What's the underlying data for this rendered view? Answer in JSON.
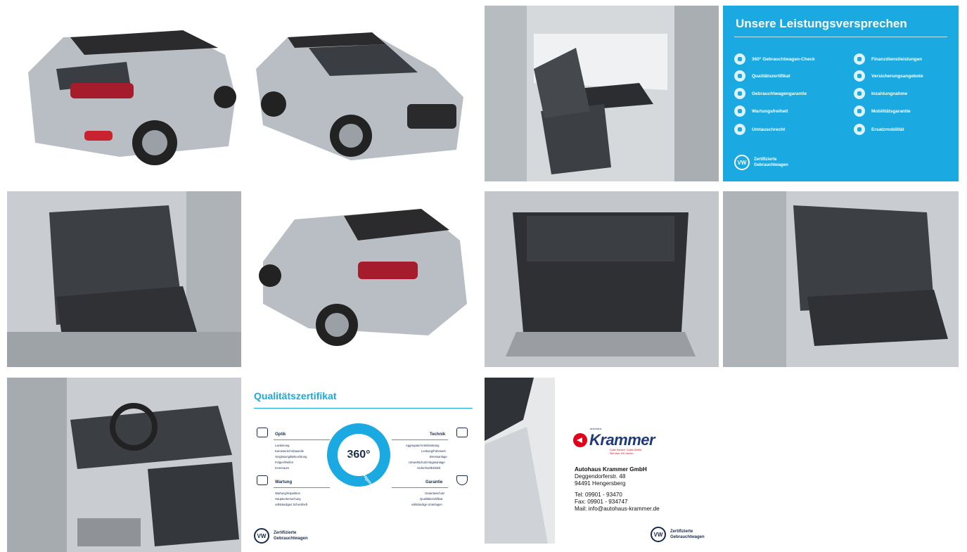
{
  "gallery": {
    "photos": [
      {
        "subject": "rear-three-quarter-exterior"
      },
      {
        "subject": "front-three-quarter-exterior"
      },
      {
        "subject": "front-passenger-interior"
      },
      {
        "subject": "rear-seats-interior"
      },
      {
        "subject": "rear-three-quarter-exterior-left"
      },
      {
        "subject": "trunk-cargo-area"
      },
      {
        "subject": "rear-seats-interior-right"
      },
      {
        "subject": "driver-cockpit-interior"
      }
    ]
  },
  "promise_card": {
    "title": "Unsere Leistungsversprechen",
    "left_items": [
      "360° Gebrauchtwagen-Check",
      "Qualitätszertifikat",
      "Gebrauchtwagengarantie",
      "Wartungsfreiheit",
      "Umtauschrecht"
    ],
    "right_items": [
      "Finanzdienstleistungen",
      "Versicherungsangebote",
      "Inzahlungnahme",
      "Mobilitätsgarantie",
      "Ersatzmobilität"
    ],
    "footer_line1": "Zertifizierte",
    "footer_line2": "Gebrauchtwagen",
    "logo_text": "VW",
    "background": "#1ba9e1"
  },
  "cert_card": {
    "title": "Qualitätszertifikat",
    "optik_title": "Optik",
    "optik_items": [
      "Lackierung",
      "Karosserie/Anbauteile",
      "Verglasung/Beleuchtung",
      "Felgen/Reifen",
      "Innenraum"
    ],
    "technik_title": "Technik",
    "technik_items": [
      "Aggregate/Antriebsstrang",
      "Lenkung/Fahrwerk",
      "Bremsanlage",
      "Umweltschutz/Abgasanlage",
      "Sicherheit/Elektrik"
    ],
    "wartung_title": "Wartung",
    "wartung_items": [
      "Wartung/Inspektion",
      "Hauptuntersuchung",
      "vollständiges Scheckheft"
    ],
    "garantie_title": "Garantie",
    "garantie_items": [
      "Garantieschutz",
      "Qualitätszertifikat",
      "vollständige Unterlagen"
    ],
    "center_text": "360°",
    "ring_text": "Gebrauchtwagen-Check",
    "footer_line1": "Zertifizierte",
    "footer_line2": "Gebrauchtwagen",
    "logo_text": "VW"
  },
  "dealer_card": {
    "small_top": "autohaus",
    "brand": "Krammer",
    "slogan_1": "Guter Service. Gutes Gefühl.",
    "slogan_2": "Seit über 100 Jahren.",
    "company": "Autohaus Krammer GmbH",
    "street": "Deggendorferstr. 48",
    "city": "94491 Hengersberg",
    "tel": "Tel:  09901 - 93470",
    "fax": "Fax: 09901 - 934747",
    "mail": "Mail: info@autohaus-krammer.de",
    "footer_line1": "Zertifizierte",
    "footer_line2": "Gebrauchtwagen",
    "logo_text": "VW"
  }
}
